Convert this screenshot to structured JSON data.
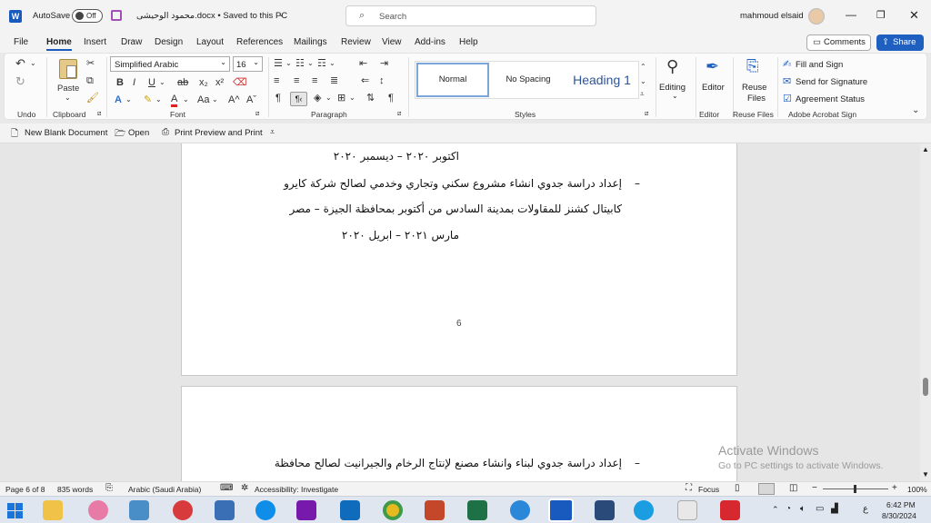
{
  "titlebar": {
    "word_logo": "W",
    "autosave_label": "AutoSave",
    "autosave_state": "Off",
    "doc_title": "محمود الوحيشى.docx • Saved to this PC",
    "search_placeholder": "Search",
    "user_name": "mahmoud elsaid"
  },
  "tabs": [
    "File",
    "Home",
    "Insert",
    "Draw",
    "Design",
    "Layout",
    "References",
    "Mailings",
    "Review",
    "View",
    "Add-ins",
    "Help"
  ],
  "share": {
    "comments": "Comments",
    "share": "Share"
  },
  "ribbon": {
    "undo_group": "Undo",
    "clipboard": {
      "paste": "Paste",
      "group": "Clipboard"
    },
    "font": {
      "name": "Simplified Arabic",
      "size": "16",
      "group": "Font",
      "bold": "B",
      "italic": "I",
      "underline": "U",
      "strike": "ab",
      "subscript": "x₂",
      "superscript": "x²",
      "font_color_a": "A",
      "grow": "A^",
      "shrink": "Aˇ",
      "change_case": "Aa"
    },
    "paragraph": {
      "group": "Paragraph"
    },
    "styles": {
      "items": [
        "Normal",
        "No Spacing",
        "Heading 1"
      ],
      "group": "Styles"
    },
    "editing": {
      "label": "Editing"
    },
    "editor": {
      "label": "Editor",
      "group": "Editor"
    },
    "reuse": {
      "label_1": "Reuse",
      "label_2": "Files",
      "group": "Reuse Files"
    },
    "acrobat": {
      "fill": "Fill and Sign",
      "send": "Send for Signature",
      "status": "Agreement Status",
      "group": "Adobe Acrobat Sign"
    }
  },
  "qat": {
    "new_blank": "New Blank Document",
    "open": "Open",
    "print_preview": "Print Preview and Print"
  },
  "document": {
    "page1_lines": [
      "اكتوبر ٢٠٢٠ – ديسمبر ٢٠٢٠",
      "إعداد دراسة جدوي انشاء مشروع سكني وتجاري وخدمي لصالح شركة كايرو",
      "كابيتال كشنز للمقاولات بمدينة السادس من أكتوبر بمحافظة الجيزة – مصر",
      "مارس ٢٠٢١ – ابريل ٢٠٢٠"
    ],
    "page_number": "6",
    "page2_line": "إعداد دراسة جدوي لبناء وانشاء مصنع لإنتاج الرخام والجيرانيت لصالح محافظة",
    "bullet": "–"
  },
  "watermark": {
    "title": "Activate Windows",
    "subtitle": "Go to PC settings to activate Windows."
  },
  "status": {
    "page": "Page 6 of 8",
    "words": "835 words",
    "language": "Arabic (Saudi Arabia)",
    "accessibility": "Accessibility: Investigate",
    "focus": "Focus",
    "zoom": "100%"
  },
  "taskbar": {
    "time": "6:42 PM",
    "date": "8/30/2024",
    "lang": "ع"
  },
  "colors": {
    "word_blue": "#185abd",
    "share_blue": "#1f5fbf",
    "heading_blue": "#2f5496"
  }
}
